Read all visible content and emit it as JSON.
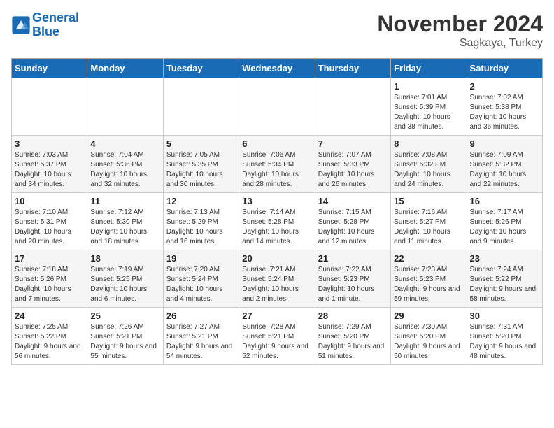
{
  "header": {
    "logo_line1": "General",
    "logo_line2": "Blue",
    "month": "November 2024",
    "location": "Sagkaya, Turkey"
  },
  "weekdays": [
    "Sunday",
    "Monday",
    "Tuesday",
    "Wednesday",
    "Thursday",
    "Friday",
    "Saturday"
  ],
  "weeks": [
    [
      {
        "day": "",
        "info": ""
      },
      {
        "day": "",
        "info": ""
      },
      {
        "day": "",
        "info": ""
      },
      {
        "day": "",
        "info": ""
      },
      {
        "day": "",
        "info": ""
      },
      {
        "day": "1",
        "info": "Sunrise: 7:01 AM\nSunset: 5:39 PM\nDaylight: 10 hours and 38 minutes."
      },
      {
        "day": "2",
        "info": "Sunrise: 7:02 AM\nSunset: 5:38 PM\nDaylight: 10 hours and 36 minutes."
      }
    ],
    [
      {
        "day": "3",
        "info": "Sunrise: 7:03 AM\nSunset: 5:37 PM\nDaylight: 10 hours and 34 minutes."
      },
      {
        "day": "4",
        "info": "Sunrise: 7:04 AM\nSunset: 5:36 PM\nDaylight: 10 hours and 32 minutes."
      },
      {
        "day": "5",
        "info": "Sunrise: 7:05 AM\nSunset: 5:35 PM\nDaylight: 10 hours and 30 minutes."
      },
      {
        "day": "6",
        "info": "Sunrise: 7:06 AM\nSunset: 5:34 PM\nDaylight: 10 hours and 28 minutes."
      },
      {
        "day": "7",
        "info": "Sunrise: 7:07 AM\nSunset: 5:33 PM\nDaylight: 10 hours and 26 minutes."
      },
      {
        "day": "8",
        "info": "Sunrise: 7:08 AM\nSunset: 5:32 PM\nDaylight: 10 hours and 24 minutes."
      },
      {
        "day": "9",
        "info": "Sunrise: 7:09 AM\nSunset: 5:32 PM\nDaylight: 10 hours and 22 minutes."
      }
    ],
    [
      {
        "day": "10",
        "info": "Sunrise: 7:10 AM\nSunset: 5:31 PM\nDaylight: 10 hours and 20 minutes."
      },
      {
        "day": "11",
        "info": "Sunrise: 7:12 AM\nSunset: 5:30 PM\nDaylight: 10 hours and 18 minutes."
      },
      {
        "day": "12",
        "info": "Sunrise: 7:13 AM\nSunset: 5:29 PM\nDaylight: 10 hours and 16 minutes."
      },
      {
        "day": "13",
        "info": "Sunrise: 7:14 AM\nSunset: 5:28 PM\nDaylight: 10 hours and 14 minutes."
      },
      {
        "day": "14",
        "info": "Sunrise: 7:15 AM\nSunset: 5:28 PM\nDaylight: 10 hours and 12 minutes."
      },
      {
        "day": "15",
        "info": "Sunrise: 7:16 AM\nSunset: 5:27 PM\nDaylight: 10 hours and 11 minutes."
      },
      {
        "day": "16",
        "info": "Sunrise: 7:17 AM\nSunset: 5:26 PM\nDaylight: 10 hours and 9 minutes."
      }
    ],
    [
      {
        "day": "17",
        "info": "Sunrise: 7:18 AM\nSunset: 5:26 PM\nDaylight: 10 hours and 7 minutes."
      },
      {
        "day": "18",
        "info": "Sunrise: 7:19 AM\nSunset: 5:25 PM\nDaylight: 10 hours and 6 minutes."
      },
      {
        "day": "19",
        "info": "Sunrise: 7:20 AM\nSunset: 5:24 PM\nDaylight: 10 hours and 4 minutes."
      },
      {
        "day": "20",
        "info": "Sunrise: 7:21 AM\nSunset: 5:24 PM\nDaylight: 10 hours and 2 minutes."
      },
      {
        "day": "21",
        "info": "Sunrise: 7:22 AM\nSunset: 5:23 PM\nDaylight: 10 hours and 1 minute."
      },
      {
        "day": "22",
        "info": "Sunrise: 7:23 AM\nSunset: 5:23 PM\nDaylight: 9 hours and 59 minutes."
      },
      {
        "day": "23",
        "info": "Sunrise: 7:24 AM\nSunset: 5:22 PM\nDaylight: 9 hours and 58 minutes."
      }
    ],
    [
      {
        "day": "24",
        "info": "Sunrise: 7:25 AM\nSunset: 5:22 PM\nDaylight: 9 hours and 56 minutes."
      },
      {
        "day": "25",
        "info": "Sunrise: 7:26 AM\nSunset: 5:21 PM\nDaylight: 9 hours and 55 minutes."
      },
      {
        "day": "26",
        "info": "Sunrise: 7:27 AM\nSunset: 5:21 PM\nDaylight: 9 hours and 54 minutes."
      },
      {
        "day": "27",
        "info": "Sunrise: 7:28 AM\nSunset: 5:21 PM\nDaylight: 9 hours and 52 minutes."
      },
      {
        "day": "28",
        "info": "Sunrise: 7:29 AM\nSunset: 5:20 PM\nDaylight: 9 hours and 51 minutes."
      },
      {
        "day": "29",
        "info": "Sunrise: 7:30 AM\nSunset: 5:20 PM\nDaylight: 9 hours and 50 minutes."
      },
      {
        "day": "30",
        "info": "Sunrise: 7:31 AM\nSunset: 5:20 PM\nDaylight: 9 hours and 48 minutes."
      }
    ]
  ]
}
